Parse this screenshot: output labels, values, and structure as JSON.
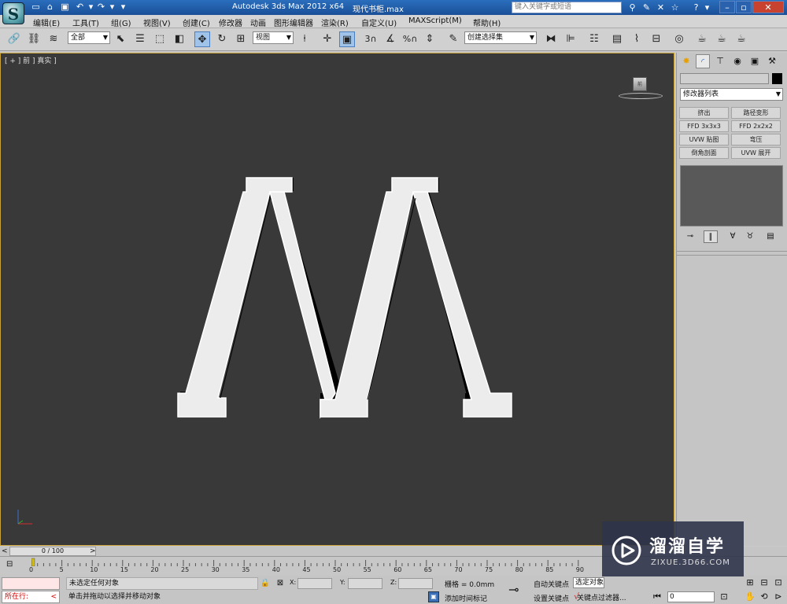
{
  "titlebar": {
    "app_logo": "S",
    "app_title": "Autodesk 3ds Max  2012 x64",
    "file_name": "现代书柜.max",
    "search_placeholder": "键入关键字或短语",
    "icons": [
      "binoculars-icon",
      "tools-icon",
      "exchange-icon",
      "star-icon",
      "help-icon"
    ]
  },
  "menu": {
    "items": [
      "编辑(E)",
      "工具(T)",
      "组(G)",
      "视图(V)",
      "创建(C)",
      "修改器",
      "动画",
      "图形编辑器",
      "渲染(R)",
      "自定义(U)",
      "MAXScript(M)",
      "帮助(H)"
    ]
  },
  "toolbar": {
    "selection_filter": "全部",
    "ref_coord": "视图",
    "named_selection": "创建选择集",
    "snap_label": "3",
    "percent_label": "%"
  },
  "viewport": {
    "label": "[ + ] 前 ] 真实 ]",
    "viewcube_label": "前",
    "object_letter": "M",
    "background": "#393939",
    "border_color": "#c9a23a"
  },
  "command_panel": {
    "modifier_list": "修改器列表",
    "modifier_buttons": [
      "挤出",
      "路径变形",
      "FFD 3x3x3",
      "FFD 2x2x2",
      "UVW 贴图",
      "弯压",
      "倒角剖面",
      "UVW 展开"
    ]
  },
  "timeline": {
    "frame_display": "0 / 100",
    "ticks": [
      "0",
      "5",
      "10",
      "15",
      "20",
      "25",
      "30",
      "35",
      "40",
      "45",
      "50",
      "55",
      "60",
      "65",
      "70",
      "75",
      "80",
      "85",
      "90"
    ]
  },
  "status": {
    "running": "所在行:",
    "selection_text": "未选定任何对象",
    "prompt_text": "单击并拖动以选择并移动对象",
    "x_label": "X:",
    "y_label": "Y:",
    "z_label": "Z:",
    "grid_text": "栅格 = 0.0mm",
    "add_time_tag": "添加时间标记",
    "auto_key": "自动关键点",
    "set_key": "设置关键点",
    "key_set_select": "选定对象",
    "key_filter": "关键点过滤器...",
    "frame_field": "0"
  },
  "watermark": {
    "title": "溜溜自学",
    "url": "ZIXUE.3D66.COM"
  }
}
